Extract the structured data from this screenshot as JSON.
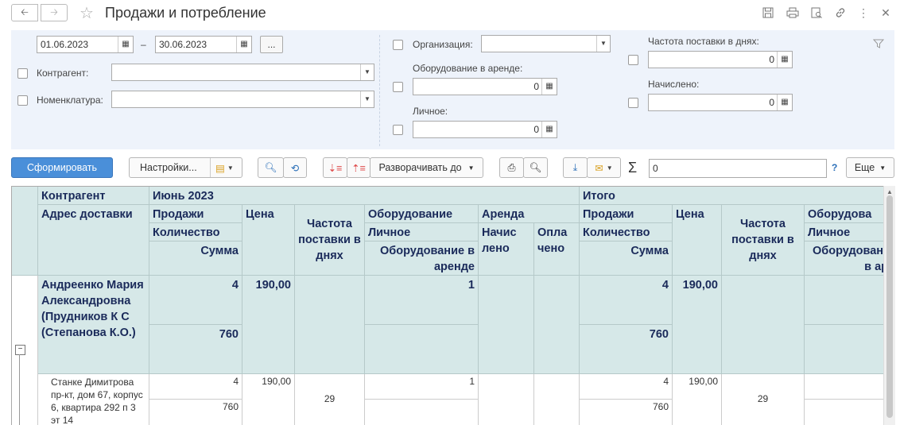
{
  "window": {
    "title": "Продажи и потребление"
  },
  "filters": {
    "date_from": "01.06.2023",
    "date_sep": "–",
    "date_to": "30.06.2023",
    "period_btn": "...",
    "kontragent_label": "Контрагент:",
    "nomenklatura_label": "Номенклатура:",
    "organizatsiya_label": "Организация:",
    "oborudovanie_label": "Оборудование в аренде:",
    "oborudovanie_value": "0",
    "lichnoe_label": "Личное:",
    "lichnoe_value": "0",
    "chastota_label": "Частота поставки в днях:",
    "chastota_value": "0",
    "nachisleno_label": "Начислено:",
    "nachisleno_value": "0"
  },
  "toolbar": {
    "generate": "Сформировать",
    "settings": "Настройки...",
    "expand_to": "Разворачивать до",
    "sum_value": "0",
    "help": "?",
    "more": "Еще"
  },
  "table": {
    "h_kontragent": "Контрагент",
    "h_address": "Адрес доставки",
    "h_june": "Июнь 2023",
    "h_itogo": "Итого",
    "h_prodazhi": "Продажи",
    "h_kolichestvo": "Количество",
    "h_summa": "Сумма",
    "h_tsena": "Цена",
    "h_chastota": "Частота поставки в днях",
    "h_oborudovanie": "Оборудование",
    "h_lichnoe": "Личное",
    "h_oborud_arenda": "Оборудование в аренде",
    "h_arenda": "Аренда",
    "h_nachisleno": "Начис лено",
    "h_oplacheno": "Опла чено",
    "h_oborudova_cut": "Оборудова",
    "h_oborudovanie_cut": "Оборудование",
    "h_v_ar_cut": "в ар",
    "group_name": "Андреенко Мария Александровна (Прудников К С (Степанова К.О.)",
    "group_qty": "4",
    "group_price": "190,00",
    "group_oborud": "1",
    "group_sum": "760",
    "group_itogo_qty": "4",
    "group_itogo_price": "190,00",
    "group_itogo_sum": "760",
    "row_address": "Станке Димитрова пр-кт,  дом 67,  корпус 6,  квартира 292  п 3   эт 14",
    "row_qty": "4",
    "row_price": "190,00",
    "row_chastota": "29",
    "row_oborud": "1",
    "row_sum": "760",
    "row_itogo_qty": "4",
    "row_itogo_price": "190,00",
    "row_itogo_sum": "760",
    "row_itogo_chastota": "29"
  }
}
